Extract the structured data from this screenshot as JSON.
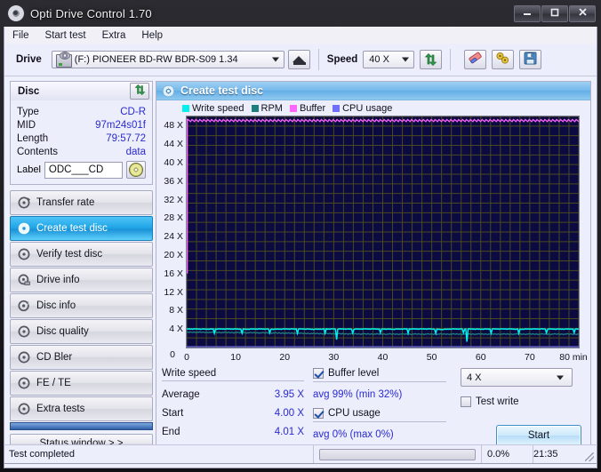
{
  "window": {
    "title": "Opti Drive Control 1.70",
    "icon": "disc-icon",
    "minimize": "–",
    "maximize": "□",
    "close": "✕"
  },
  "menu": {
    "items": [
      {
        "label": "File"
      },
      {
        "label": "Start test"
      },
      {
        "label": "Extra"
      },
      {
        "label": "Help"
      }
    ]
  },
  "toolbar": {
    "drive_label": "Drive",
    "drive_value": "(F:)  PIONEER BD-RW   BDR-S09 1.34",
    "eject_icon": "eject-icon",
    "speed_label": "Speed",
    "speed_value": "40 X",
    "refresh_icon": "refresh-arrows-icon",
    "erase_icon": "eraser-icon",
    "tools_icon": "settings-tools-icon",
    "save_icon": "floppy-save-icon"
  },
  "disc": {
    "header": "Disc",
    "refresh_icon": "refresh-arrows-icon",
    "rows": [
      {
        "key": "Type",
        "value": "CD-R"
      },
      {
        "key": "MID",
        "value": "97m24s01f"
      },
      {
        "key": "Length",
        "value": "79:57.72"
      },
      {
        "key": "Contents",
        "value": "data"
      }
    ],
    "label_key": "Label",
    "label_value": "ODC___CD",
    "label_button_icon": "cd-disc-icon"
  },
  "nav": {
    "items": [
      {
        "label": "Transfer rate",
        "icon": "disc-speed-icon",
        "selected": false
      },
      {
        "label": "Create test disc",
        "icon": "disc-write-icon",
        "selected": true
      },
      {
        "label": "Verify test disc",
        "icon": "disc-verify-icon",
        "selected": false
      },
      {
        "label": "Drive info",
        "icon": "drive-info-icon",
        "selected": false
      },
      {
        "label": "Disc info",
        "icon": "disc-info-icon",
        "selected": false
      },
      {
        "label": "Disc quality",
        "icon": "disc-quality-icon",
        "selected": false
      },
      {
        "label": "CD Bler",
        "icon": "cd-bler-icon",
        "selected": false
      },
      {
        "label": "FE / TE",
        "icon": "fe-te-icon",
        "selected": false
      },
      {
        "label": "Extra tests",
        "icon": "extra-tests-icon",
        "selected": false
      }
    ],
    "status_window": "Status window > >"
  },
  "panel": {
    "title": "Create test disc",
    "icon": "disc-write-icon"
  },
  "chart_data": {
    "type": "line",
    "title": "Create test disc",
    "xlabel": "min",
    "ylabel": "X",
    "xlim": [
      0,
      80
    ],
    "ylim": [
      0,
      50
    ],
    "xticks": [
      0,
      10,
      20,
      30,
      40,
      50,
      60,
      70,
      80
    ],
    "xticklabels": [
      "0",
      "10",
      "20",
      "30",
      "40",
      "50",
      "60",
      "70",
      "80 min"
    ],
    "yticks": [
      4,
      8,
      12,
      16,
      20,
      24,
      28,
      32,
      36,
      40,
      44,
      48
    ],
    "yticklabels": [
      "4 X",
      "8 X",
      "12 X",
      "16 X",
      "20 X",
      "24 X",
      "28 X",
      "32 X",
      "36 X",
      "40 X",
      "44 X",
      "48 X"
    ],
    "y_origin_label": "0",
    "grid": true,
    "background": "#0b0b42",
    "gridcolor": "#4a4a1e",
    "legend_position": "top-left",
    "series": [
      {
        "name": "Write speed",
        "color": "#00f0f0",
        "unit": "X",
        "values": [
          4.0,
          4.0,
          3.97,
          4.0,
          4.0,
          4.0,
          3.95,
          4.0,
          4.0,
          3.96,
          4.0,
          4.0,
          4.0,
          3.94,
          4.0,
          4.0,
          4.0,
          3.97,
          4.0,
          4.0,
          4.0,
          3.95,
          4.0,
          4.0,
          4.0,
          4.0,
          3.9,
          4.0,
          4.0,
          4.0,
          3.96,
          4.0,
          4.0,
          4.0,
          3.95,
          4.0,
          4.0,
          4.0,
          3.97,
          4.0,
          4.01
        ]
      },
      {
        "name": "RPM",
        "color": "#1d7f7f",
        "unit": "rpm",
        "values": [
          3.3,
          3.3,
          3.28,
          3.26,
          3.24,
          3.22,
          3.2,
          3.18,
          3.16,
          3.14,
          3.1,
          3.08,
          3.05,
          3.02,
          3.0,
          2.98,
          2.96,
          2.95,
          2.93,
          2.92,
          2.9,
          2.9,
          2.9,
          2.9,
          2.9,
          2.9,
          2.9,
          2.9,
          2.9,
          2.9,
          2.9,
          2.9,
          2.9,
          2.9,
          2.9,
          2.9,
          2.9,
          2.9,
          2.9,
          2.9,
          2.9
        ]
      },
      {
        "name": "Buffer",
        "color": "#ff66ff",
        "unit": "%",
        "values": [
          32,
          99,
          99,
          98,
          99,
          99,
          98,
          99,
          99,
          99,
          98,
          99,
          99,
          99,
          98,
          99,
          99,
          99,
          98,
          99,
          99,
          99,
          99,
          98,
          99,
          99,
          99,
          98,
          99,
          99,
          99,
          99,
          98,
          99,
          99,
          99,
          98,
          99,
          99,
          99,
          99
        ]
      },
      {
        "name": "CPU usage",
        "color": "#6f6fff",
        "unit": "%",
        "values": [
          0,
          0,
          0,
          0,
          0,
          0,
          0,
          0,
          0,
          0,
          0,
          0,
          0,
          0,
          0,
          0,
          0,
          0,
          0,
          0,
          0,
          0,
          0,
          0,
          0,
          0,
          0,
          0,
          0,
          0,
          0,
          0,
          0,
          0,
          0,
          0,
          0,
          0,
          0,
          0,
          0
        ]
      }
    ]
  },
  "stats": {
    "write_speed_header": "Write speed",
    "rows": [
      {
        "key": "Average",
        "value": "3.95 X"
      },
      {
        "key": "Start",
        "value": "4.00 X"
      },
      {
        "key": "End",
        "value": "4.01 X"
      }
    ],
    "buffer_label": "Buffer level",
    "buffer_checked": true,
    "buffer_value": "avg 99% (min 32%)",
    "cpu_label": "CPU usage",
    "cpu_checked": true,
    "cpu_value": "avg 0% (max 0%)",
    "write_speed_select": "4 X",
    "test_write_label": "Test write",
    "test_write_checked": false,
    "start_button": "Start"
  },
  "statusbar": {
    "message": "Test completed",
    "progress_percent": "0.0%",
    "progress_value": 0,
    "time": "21:35"
  }
}
